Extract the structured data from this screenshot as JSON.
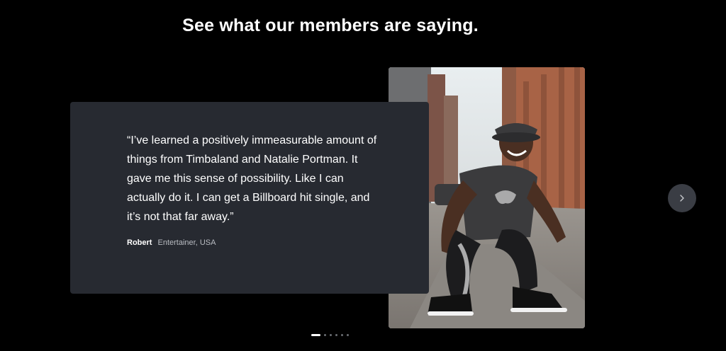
{
  "section": {
    "heading": "See what our members are saying."
  },
  "testimonial": {
    "quote": "“I’ve learned a positively immeasurable amount of things from Timbaland and Natalie Portman. It gave me this sense of possibility. Like I can actually do it. I can get a Billboard hit single, and it’s not that far away.”",
    "author_name": "Robert",
    "author_role": "Entertainer, USA",
    "photo_subject": "smiling man in fedora crouching on city street"
  },
  "carousel": {
    "next_icon": "chevron-right-icon",
    "dot_count": 6,
    "active_index": 0
  },
  "colors": {
    "background": "#000000",
    "card": "#272a31",
    "next_button": "#3a3d44",
    "dot_inactive": "#6a6d72",
    "dot_active": "#ffffff"
  }
}
